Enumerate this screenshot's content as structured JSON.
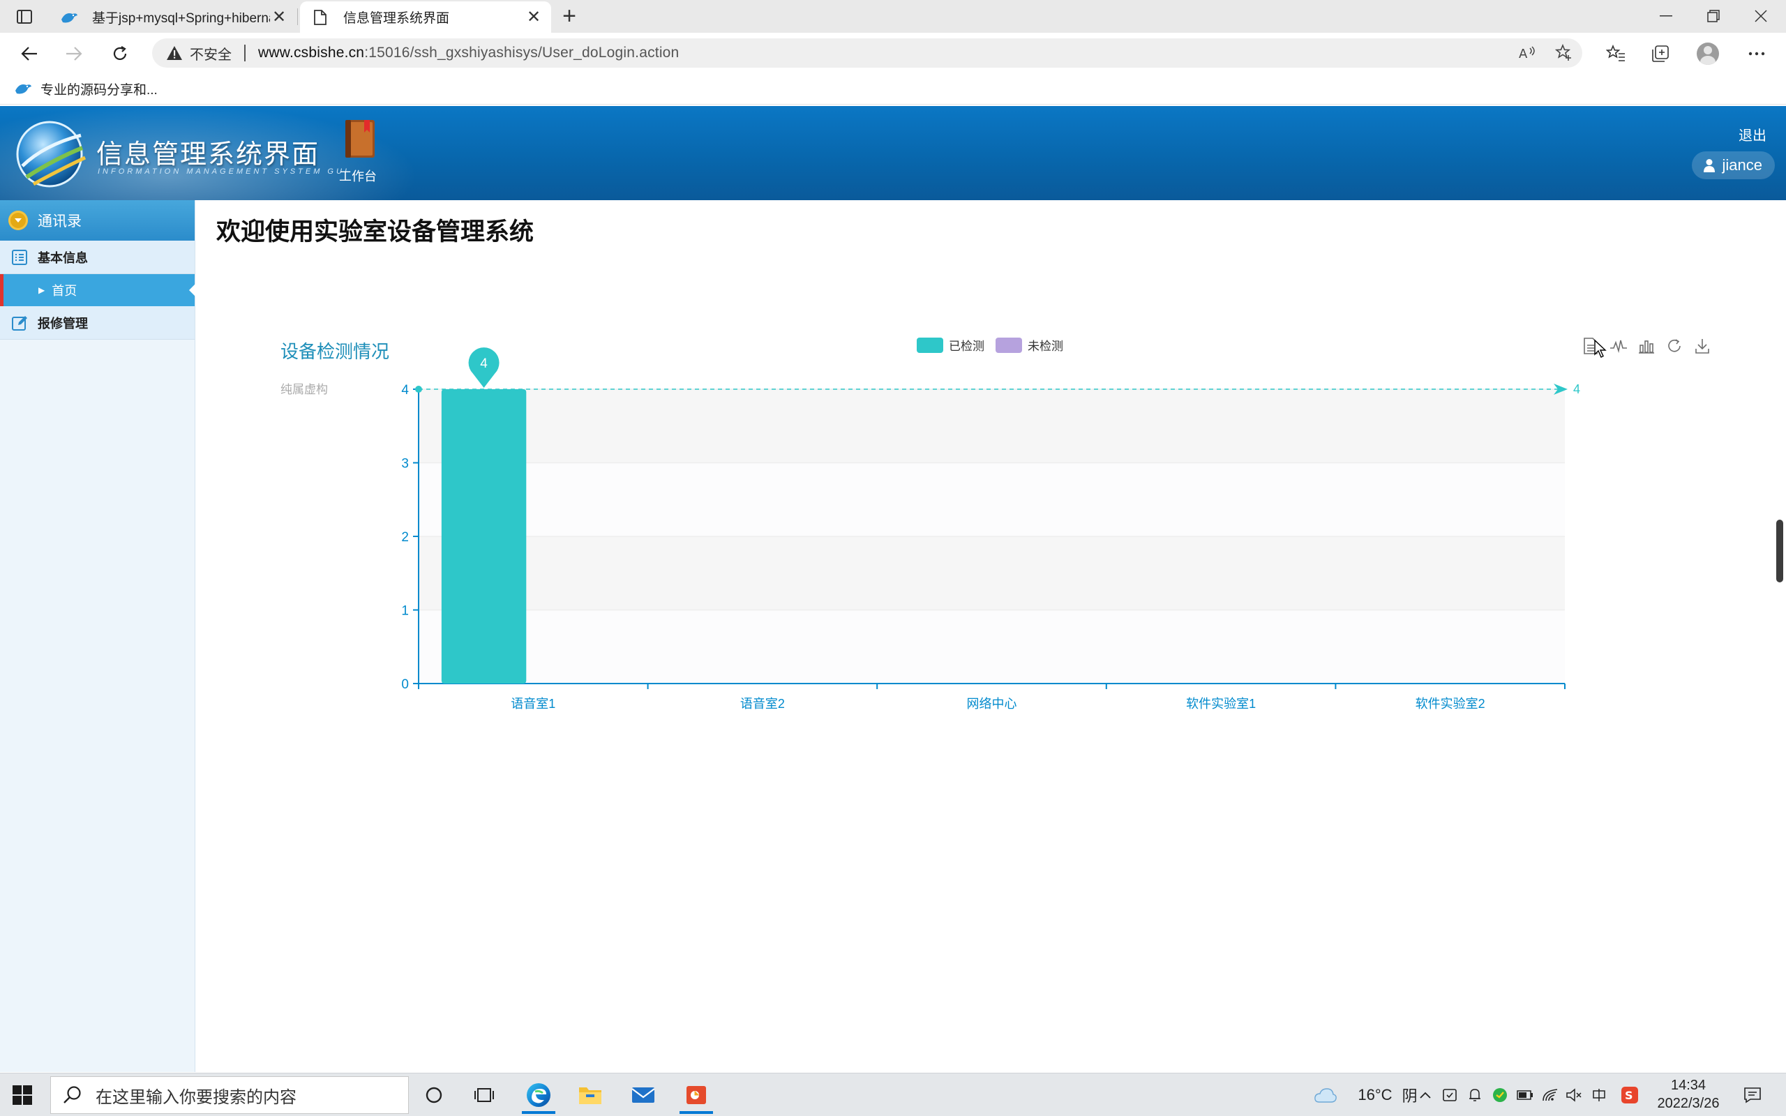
{
  "browser": {
    "tabs": [
      {
        "title": "基于jsp+mysql+Spring+hibernate",
        "icon": "bird-favicon"
      },
      {
        "title": "信息管理系统界面",
        "icon": "page-icon"
      }
    ],
    "address": {
      "security_label": "不安全",
      "url_host": "www.csbishe.cn",
      "url_rest": ":15016/ssh_gxshiyashisys/User_doLogin.action"
    },
    "bookmarks": [
      {
        "label": "专业的源码分享和..."
      }
    ]
  },
  "app": {
    "logo_title": "信息管理系统界面",
    "logo_subtitle": "INFORMATION MANAGEMENT SYSTEM GUI",
    "workbench_label": "工作台",
    "logout_label": "退出",
    "username": "jiance"
  },
  "sidebar": {
    "top_label": "通讯录",
    "groups": [
      {
        "label": "基本信息",
        "items": [
          {
            "label": "首页",
            "active": true
          }
        ]
      },
      {
        "label": "报修管理",
        "items": []
      }
    ]
  },
  "main": {
    "title": "欢迎使用实验室设备管理系统"
  },
  "chart_data": {
    "type": "bar",
    "title": "设备检测情况",
    "subtext": "纯属虚构",
    "categories": [
      "语音室1",
      "语音室2",
      "网络中心",
      "软件实验室1",
      "软件实验室2"
    ],
    "series": [
      {
        "name": "已检测",
        "values": [
          4,
          0,
          0,
          0,
          0
        ],
        "color": "#2ec7c9"
      },
      {
        "name": "未检测",
        "values": [
          0,
          0,
          0,
          0,
          0
        ],
        "color": "#b6a2de"
      }
    ],
    "ylim": [
      0,
      4
    ],
    "yticks": [
      0,
      1,
      2,
      3,
      4
    ],
    "markPoint": {
      "value": 4,
      "category": "语音室1"
    },
    "markLine": {
      "value": 4,
      "label": "4"
    },
    "legend_position": "top-center",
    "grid": true,
    "colors": {
      "axis": "#008acd",
      "label": "#008acd"
    }
  },
  "taskbar": {
    "search_placeholder": "在这里输入你要搜索的内容",
    "weather_temp": "16°C",
    "weather_text": "阴",
    "time": "14:34",
    "date": "2022/3/26"
  }
}
